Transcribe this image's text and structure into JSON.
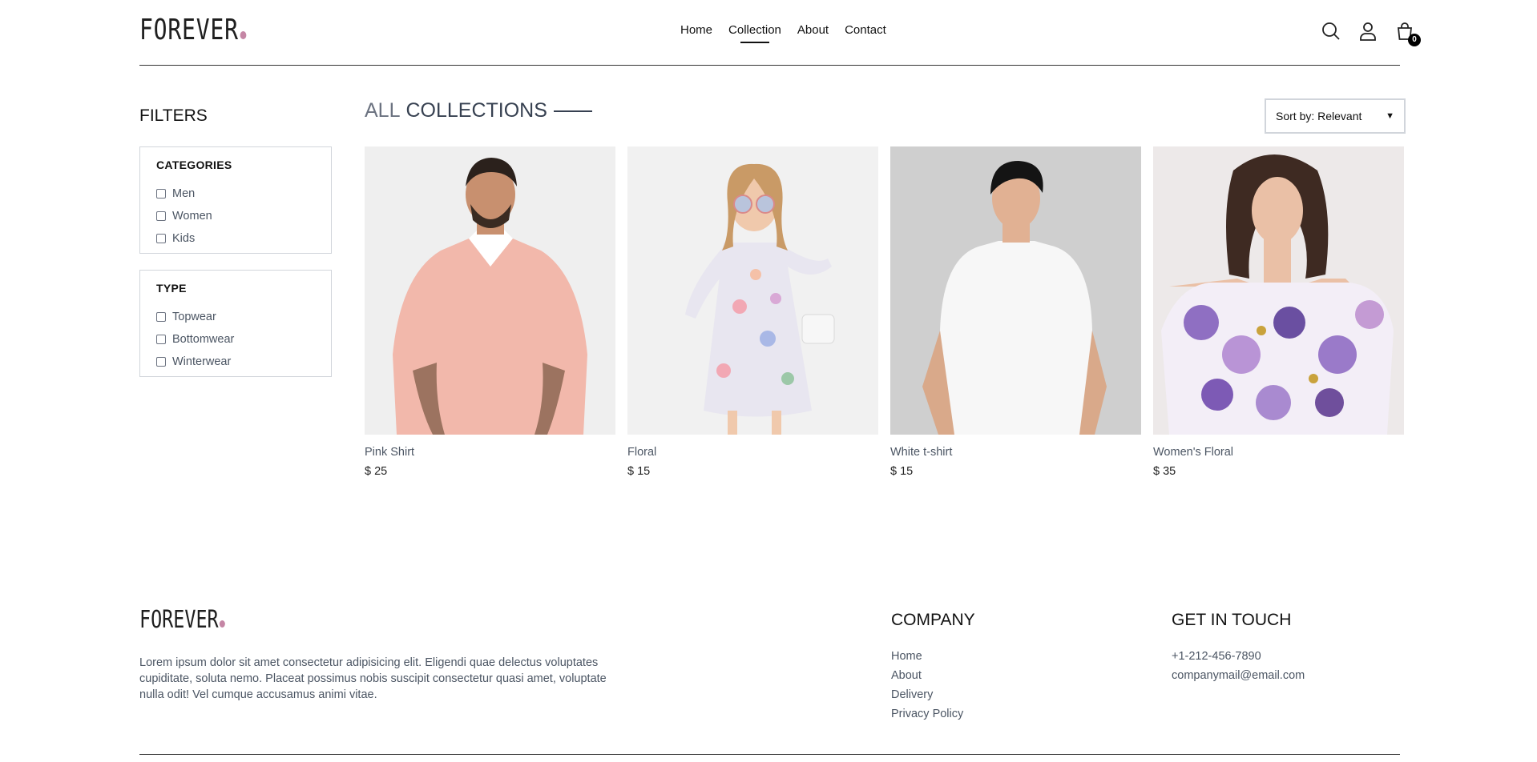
{
  "brand": {
    "name": "FOREVER",
    "dot_color": "#c586a5"
  },
  "nav": {
    "items": [
      "Home",
      "Collection",
      "About",
      "Contact"
    ],
    "active": "Collection"
  },
  "header_icons": {
    "search": "search-icon",
    "profile": "user-icon",
    "cart": "shopping-bag-icon",
    "cart_count": "0"
  },
  "filters": {
    "title": "FILTERS",
    "categories": {
      "title": "CATEGORIES",
      "options": [
        "Men",
        "Women",
        "Kids"
      ]
    },
    "type": {
      "title": "TYPE",
      "options": [
        "Topwear",
        "Bottomwear",
        "Winterwear"
      ]
    }
  },
  "collections": {
    "title_1": "ALL",
    "title_2": "COLLECTIONS"
  },
  "sort": {
    "label": "Sort by: Relevant"
  },
  "products": [
    {
      "name": "Pink Shirt",
      "price": "$ 25"
    },
    {
      "name": "Floral",
      "price": "$ 15"
    },
    {
      "name": "White t-shirt",
      "price": "$ 15"
    },
    {
      "name": "Women's Floral",
      "price": "$ 35"
    }
  ],
  "footer": {
    "description": "Lorem ipsum dolor sit amet consectetur adipisicing elit. Eligendi quae delectus voluptates cupiditate, soluta nemo. Placeat possimus nobis suscipit consectetur quasi amet, voluptate nulla odit! Vel cumque accusamus animi vitae.",
    "company": {
      "title": "COMPANY",
      "links": [
        "Home",
        "About",
        "Delivery",
        "Privacy Policy"
      ]
    },
    "contact": {
      "title": "GET IN TOUCH",
      "phone": "+1-212-456-7890",
      "email": "companymail@email.com"
    }
  }
}
